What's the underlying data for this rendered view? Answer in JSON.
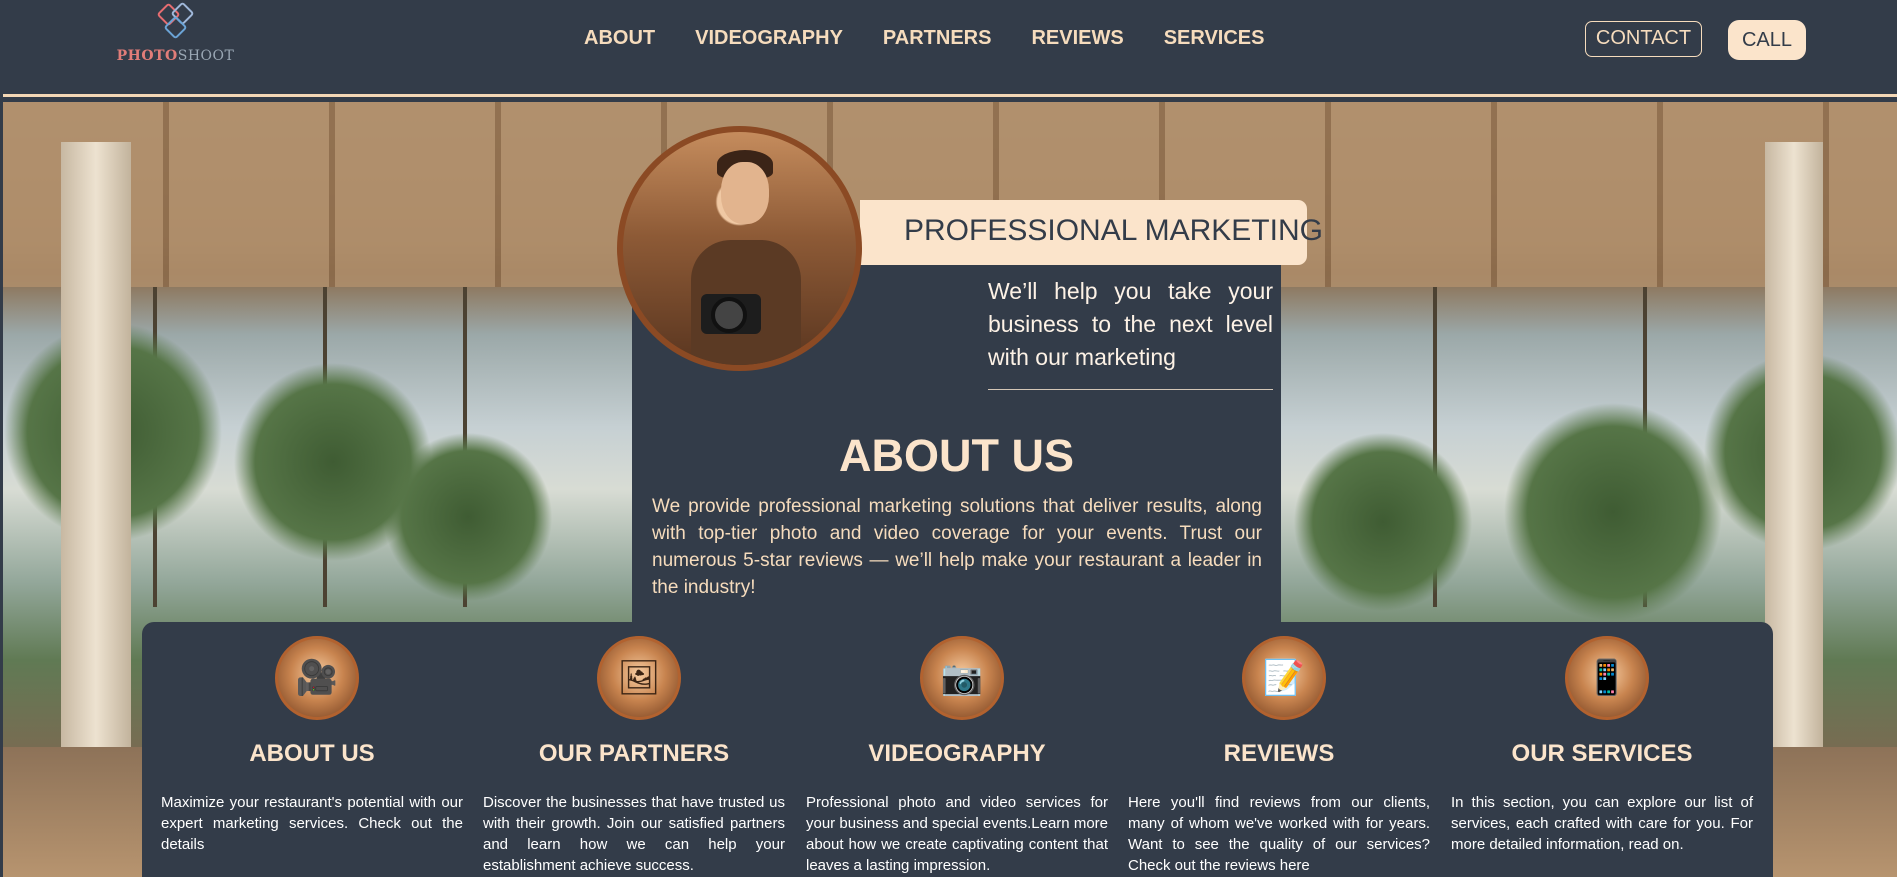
{
  "header": {
    "logo": {
      "part1": "PHOTO",
      "part2": "SHOOT"
    },
    "nav": [
      "ABOUT",
      "VIDEOGRAPHY",
      "PARTNERS",
      "REVIEWS",
      "SERVICES"
    ],
    "contact_label": "CONTACT",
    "call_label": "CALL"
  },
  "hero": {
    "tag": "PROFESSIONAL MARKETING",
    "subline": "We’ll help you take your business to the next level with our marketing",
    "about_title": "ABOUT US",
    "about_text": "We provide professional marketing solutions that deliver results, along with top-tier photo and video coverage for your events. Trust our numerous 5-star reviews — we’ll help make your restaurant a leader in the industry!"
  },
  "cards": [
    {
      "icon": "film-crew-icon",
      "title": "ABOUT US",
      "text": "Maximize your restaurant's potential with our expert marketing services. Check out the details"
    },
    {
      "icon": "photos-icon",
      "title": "OUR PARTNERS",
      "text": "Discover the businesses that have trusted us with their growth. Join our satisfied partners and learn how we can help your establishment achieve success."
    },
    {
      "icon": "camera-icon",
      "title": "VIDEOGRAPHY",
      "text": "Professional photo and video services for your business and special events.Learn more about how we create captivating content that leaves a lasting impression."
    },
    {
      "icon": "review-note-icon",
      "title": "REVIEWS",
      "text": "Here you'll find reviews from our clients, many of whom we've worked with for years. Want to see the quality of our services? Check out the reviews here"
    },
    {
      "icon": "contacts-phone-icon",
      "title": "OUR SERVICES",
      "text": "In this section, you can explore our list of services, each crafted with care for you. For more detailed information, read on."
    }
  ]
}
